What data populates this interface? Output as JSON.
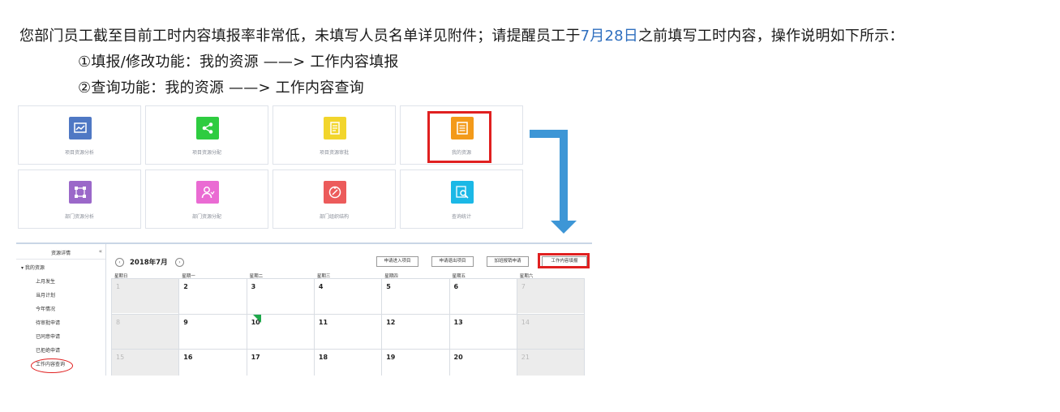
{
  "notice": {
    "line1_prefix": "您部门员工截至目前工时内容填报率非常低，未填写人员名单详见附件；请提醒员工于",
    "deadline": "7月28日",
    "line1_suffix": "之前填写工时内容，操作说明如下所示：",
    "line2": "①填报/修改功能：我的资源 ——> 工作内容填报",
    "line3": "②查询功能：我的资源 ——> 工作内容查询"
  },
  "tiles": [
    {
      "label": "项目资源分析",
      "color": "#4f78c4",
      "icon": "chart-icon"
    },
    {
      "label": "项目资源分配",
      "color": "#2ecc40",
      "icon": "share-icon"
    },
    {
      "label": "项目资源审批",
      "color": "#f2d52c",
      "icon": "document-icon"
    },
    {
      "label": "我的资源",
      "color": "#f39a1a",
      "icon": "list-icon"
    },
    {
      "label": "部门资源分析",
      "color": "#9b68c9",
      "icon": "network-icon"
    },
    {
      "label": "部门资源分配",
      "color": "#ea6bd3",
      "icon": "user-icon"
    },
    {
      "label": "部门组织结构",
      "color": "#ec5b5b",
      "icon": "compass-icon"
    },
    {
      "label": "查询统计",
      "color": "#1bb8e6",
      "icon": "search-icon"
    }
  ],
  "sidebar": {
    "title": "资源详情",
    "collapse": "«",
    "group": "▾ 我的资源",
    "items": [
      "上月发生",
      "当月计划",
      "今年情况",
      "待审批申请",
      "已同意申请",
      "已拒绝申请",
      "工作内容查询"
    ]
  },
  "calendar": {
    "prev": "‹",
    "next": "›",
    "month": "2018年7月",
    "buttons": [
      "申请进入项目",
      "申请退出项目",
      "加班报销申请",
      "工作内容填报"
    ],
    "weekdays": [
      "星期日",
      "星期一",
      "星期二",
      "星期三",
      "星期四",
      "星期五",
      "星期六"
    ],
    "weeks": [
      [
        "1",
        "2",
        "3",
        "4",
        "5",
        "6",
        "7"
      ],
      [
        "8",
        "9",
        "10",
        "11",
        "12",
        "13",
        "14"
      ],
      [
        "15",
        "16",
        "17",
        "18",
        "19",
        "20",
        "21"
      ]
    ]
  },
  "colors": {
    "highlight": "#2f6fbf",
    "red_box": "#e02020",
    "arrow": "#3d96d6",
    "green_marker": "#1ea84a"
  }
}
